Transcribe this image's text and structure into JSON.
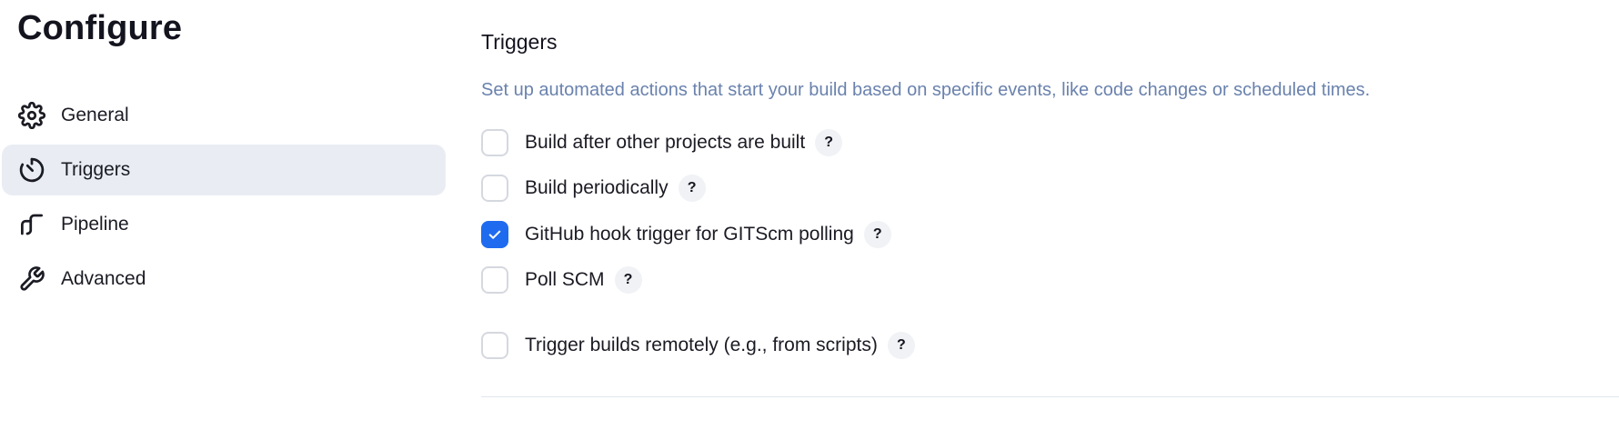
{
  "sidebar": {
    "title": "Configure",
    "items": [
      {
        "label": "General",
        "icon": "gear-icon",
        "active": false
      },
      {
        "label": "Triggers",
        "icon": "timer-icon",
        "active": true
      },
      {
        "label": "Pipeline",
        "icon": "pipeline-icon",
        "active": false
      },
      {
        "label": "Advanced",
        "icon": "wrench-icon",
        "active": false
      }
    ]
  },
  "main": {
    "section_title": "Triggers",
    "description": "Set up automated actions that start your build based on specific events, like code changes or scheduled times.",
    "options": [
      {
        "label": "Build after other projects are built",
        "checked": false,
        "help": "?"
      },
      {
        "label": "Build periodically",
        "checked": false,
        "help": "?"
      },
      {
        "label": "GitHub hook trigger for GITScm polling",
        "checked": true,
        "help": "?"
      },
      {
        "label": "Poll SCM",
        "checked": false,
        "help": "?"
      },
      {
        "label": "Trigger builds remotely (e.g., from scripts)",
        "checked": false,
        "help": "?"
      }
    ]
  },
  "colors": {
    "accent": "#1f6bf0",
    "description_text": "#6a82ad",
    "active_nav_bg": "#e9edf3"
  }
}
